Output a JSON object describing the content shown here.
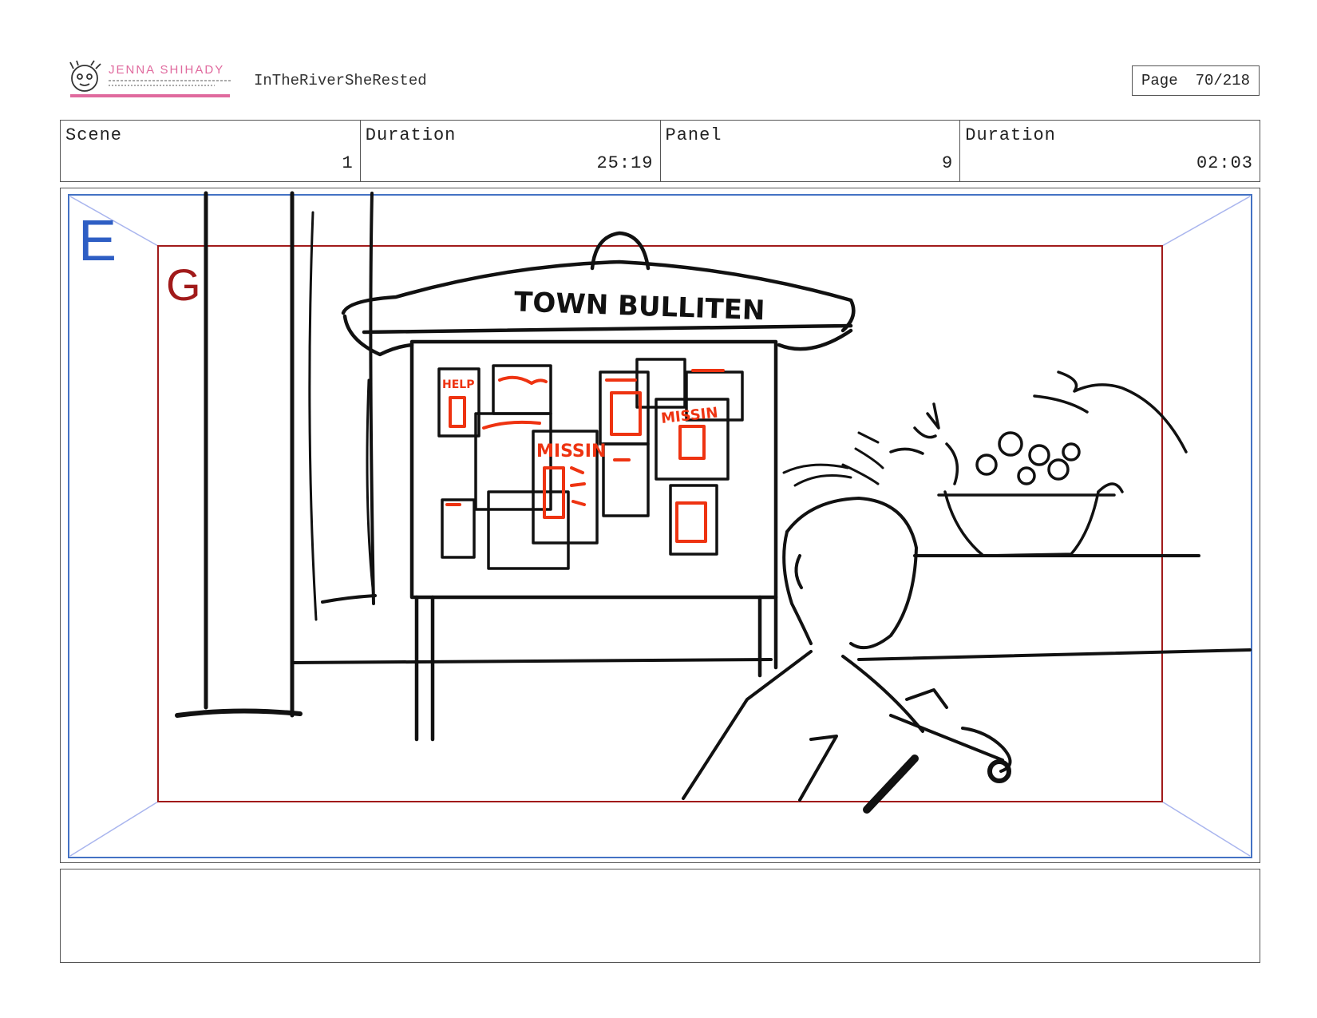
{
  "header": {
    "project_title": "InTheRiverSheRested",
    "page_label": "Page",
    "page_value": "70/218",
    "logo_text": "JENNA SHIHADY"
  },
  "info_row": [
    {
      "label": "Scene",
      "value": "1"
    },
    {
      "label": "Duration",
      "value": "25:19"
    },
    {
      "label": "Panel",
      "value": "9"
    },
    {
      "label": "Duration",
      "value": "02:03"
    }
  ],
  "panel": {
    "frame_e_label": "E",
    "frame_g_label": "G",
    "sign_text": "TOWN BULLITEN",
    "poster_text": "MISSIN",
    "poster_text_2": "MISSIN",
    "poster_text_3": "HELP"
  },
  "notes": {
    "text": ""
  },
  "colors": {
    "frame_e": "#4472c4",
    "frame_g": "#a11a1a",
    "red_ink": "#ee3311",
    "logo_pink": "#e06a9e"
  }
}
